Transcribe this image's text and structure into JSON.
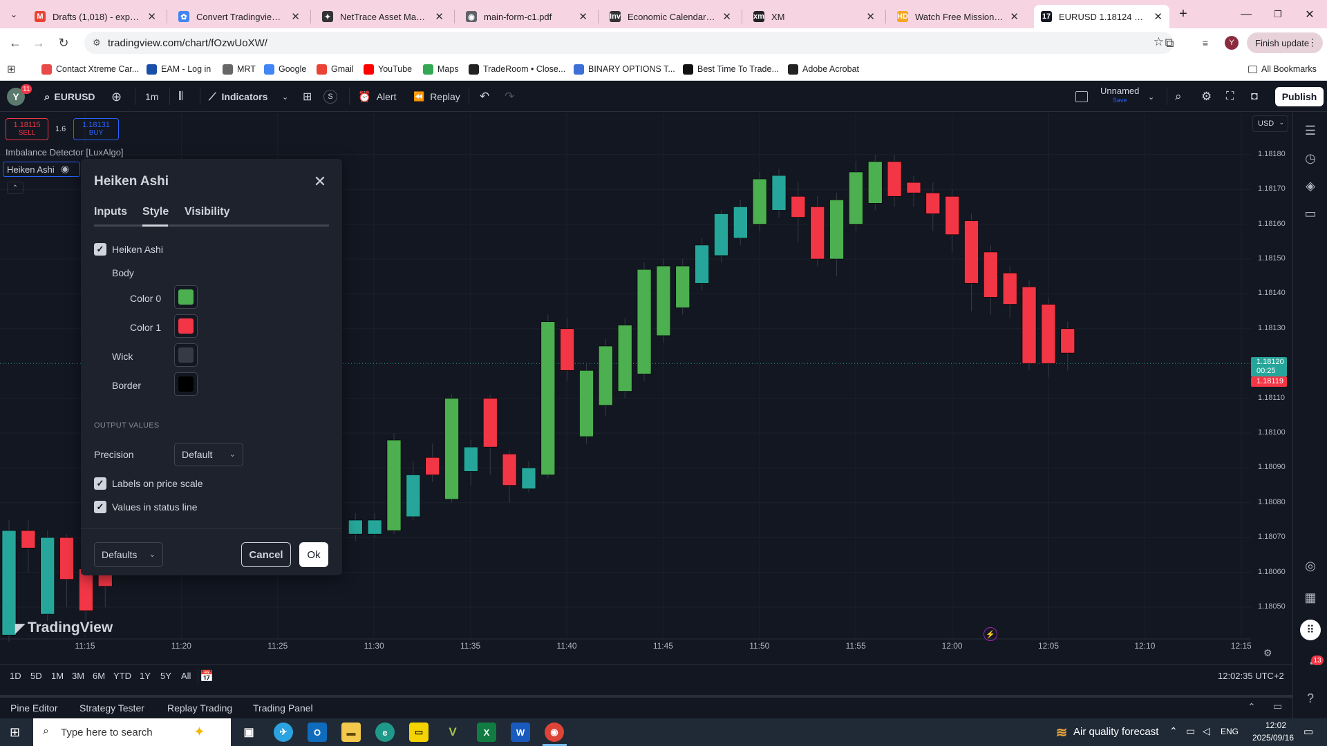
{
  "browser": {
    "tabs": [
      {
        "label": "Drafts (1,018) - experiakol",
        "fav_color": "#ea4335",
        "fav_glyph": "M"
      },
      {
        "label": "Convert Tradingview script",
        "fav_color": "#4285f4",
        "fav_glyph": "✿"
      },
      {
        "label": "NetTrace Asset Management",
        "fav_color": "#333333",
        "fav_glyph": "✦"
      },
      {
        "label": "main-form-c1.pdf",
        "fav_color": "#5f6368",
        "fav_glyph": "◉"
      },
      {
        "label": "Economic Calendar - Investing",
        "fav_color": "#333333",
        "fav_glyph": "Inv"
      },
      {
        "label": "XM",
        "fav_color": "#222222",
        "fav_glyph": "xm"
      },
      {
        "label": "Watch Free Mission: Impossible",
        "fav_color": "#f5a623",
        "fav_glyph": "HD"
      },
      {
        "label": "EURUSD 1.18124 ▲ +0.44%",
        "fav_color": "#131722",
        "fav_glyph": "17"
      }
    ],
    "new_tab_glyph": "+",
    "url": "tradingview.com/chart/fOzwUoXW/",
    "finish_update": "Finish update",
    "profile_initial": "Y",
    "bookmarks": [
      {
        "label": "Contact Xtreme Car...",
        "color": "#e84a4a"
      },
      {
        "label": "EAM - Log in",
        "color": "#1a4fa8"
      },
      {
        "label": "MRT",
        "color": "#666666"
      },
      {
        "label": "Google",
        "color": "#4285f4"
      },
      {
        "label": "Gmail",
        "color": "#ea4335"
      },
      {
        "label": "YouTube",
        "color": "#ff0000"
      },
      {
        "label": "Maps",
        "color": "#34a853"
      },
      {
        "label": "TradeRoom • Close...",
        "color": "#222222"
      },
      {
        "label": "BINARY OPTIONS T...",
        "color": "#3d6fd8"
      },
      {
        "label": "Best Time To Trade...",
        "color": "#111111"
      },
      {
        "label": "Adobe Acrobat",
        "color": "#222222"
      }
    ],
    "all_bookmarks": "All Bookmarks"
  },
  "tv": {
    "avatar": "Y",
    "notif_count": "11",
    "symbol": "EURUSD",
    "interval": "1m",
    "indicators": "Indicators",
    "alert": "Alert",
    "replay": "Replay",
    "layout_name": "Unnamed",
    "layout_status": "Save",
    "publish": "Publish",
    "currency": "USD"
  },
  "quote": {
    "sell_price": "1.18115",
    "sell_label": "SELL",
    "spread": "1.6",
    "buy_price": "1.18131",
    "buy_label": "BUY"
  },
  "indicators_on_chart": {
    "first": "Imbalance Detector [LuxAlgo]",
    "second": "Heiken Ashi"
  },
  "dialog": {
    "title": "Heiken Ashi",
    "tabs": [
      "Inputs",
      "Style",
      "Visibility"
    ],
    "active_tab": "Style",
    "heiken_ashi_label": "Heiken Ashi",
    "body_label": "Body",
    "color0_label": "Color 0",
    "color1_label": "Color 1",
    "wick_label": "Wick",
    "border_label": "Border",
    "output_values": "OUTPUT VALUES",
    "precision_label": "Precision",
    "precision_value": "Default",
    "labels_on_scale": "Labels on price scale",
    "values_in_status": "Values in status line",
    "defaults": "Defaults",
    "cancel": "Cancel",
    "ok": "Ok"
  },
  "colors": {
    "up": "#26a69a",
    "down": "#f23645",
    "bull_green": "#4caf50",
    "swatch_color0": "#4caf50",
    "swatch_color1": "#f23645",
    "swatch_wick": "#363a45",
    "swatch_border": "#000000"
  },
  "price_scale": {
    "labels": [
      "1.18180",
      "1.18170",
      "1.18160",
      "1.18150",
      "1.18140",
      "1.18130",
      "1.18110",
      "1.18100",
      "1.18090",
      "1.18080",
      "1.18070",
      "1.18060",
      "1.18050"
    ],
    "current_price": "1.18120",
    "countdown": "00:25",
    "sell_tag": "1.18119"
  },
  "time_axis": {
    "labels": [
      "11:15",
      "11:20",
      "11:25",
      "11:30",
      "11:35",
      "11:40",
      "11:45",
      "11:50",
      "11:55",
      "12:00",
      "12:05",
      "12:10",
      "12:15"
    ]
  },
  "chart_data": {
    "type": "candlestick",
    "title": "EURUSD 1m Heiken Ashi",
    "y_range": [
      1.18043,
      1.18191
    ],
    "candles": [
      {
        "t": 0,
        "o": 1.18072,
        "c": 1.18042,
        "h": 1.18075,
        "l": 1.1804,
        "dir": "up"
      },
      {
        "t": 1,
        "o": 1.18067,
        "c": 1.18072,
        "h": 1.18075,
        "l": 1.1806,
        "dir": "down"
      },
      {
        "t": 2,
        "o": 1.1807,
        "c": 1.18048,
        "h": 1.18072,
        "l": 1.18046,
        "dir": "up"
      },
      {
        "t": 3,
        "o": 1.18058,
        "c": 1.1807,
        "h": 1.18071,
        "l": 1.1805,
        "dir": "down"
      },
      {
        "t": 4,
        "o": 1.18049,
        "c": 1.18061,
        "h": 1.18063,
        "l": 1.18046,
        "dir": "down"
      },
      {
        "t": 5,
        "o": 1.18056,
        "c": 1.18062,
        "h": 1.18064,
        "l": 1.1805,
        "dir": "down"
      },
      {
        "t": 6,
        "o": 1.18062,
        "c": 1.18077,
        "h": 1.18078,
        "l": 1.18061,
        "dir": "up"
      },
      {
        "t": 18,
        "o": 1.18071,
        "c": 1.18075,
        "h": 1.18077,
        "l": 1.18069,
        "dir": "up"
      },
      {
        "t": 19,
        "o": 1.18071,
        "c": 1.18075,
        "h": 1.18077,
        "l": 1.1807,
        "dir": "up"
      },
      {
        "t": 20,
        "o": 1.18072,
        "c": 1.18098,
        "h": 1.181,
        "l": 1.18071,
        "dir": "up"
      },
      {
        "t": 21,
        "o": 1.18076,
        "c": 1.18088,
        "h": 1.18092,
        "l": 1.18075,
        "dir": "up"
      },
      {
        "t": 22,
        "o": 1.18093,
        "c": 1.18088,
        "h": 1.18097,
        "l": 1.18086,
        "dir": "down"
      },
      {
        "t": 23,
        "o": 1.18081,
        "c": 1.1811,
        "h": 1.18111,
        "l": 1.1808,
        "dir": "up"
      },
      {
        "t": 24,
        "o": 1.18089,
        "c": 1.18096,
        "h": 1.18098,
        "l": 1.18085,
        "dir": "up"
      },
      {
        "t": 25,
        "o": 1.1811,
        "c": 1.18096,
        "h": 1.18111,
        "l": 1.18088,
        "dir": "down"
      },
      {
        "t": 26,
        "o": 1.18094,
        "c": 1.18085,
        "h": 1.18095,
        "l": 1.1808,
        "dir": "down"
      },
      {
        "t": 27,
        "o": 1.18084,
        "c": 1.1809,
        "h": 1.18092,
        "l": 1.18083,
        "dir": "up"
      },
      {
        "t": 28,
        "o": 1.18088,
        "c": 1.18132,
        "h": 1.18134,
        "l": 1.18087,
        "dir": "up"
      },
      {
        "t": 29,
        "o": 1.1813,
        "c": 1.18118,
        "h": 1.18133,
        "l": 1.18115,
        "dir": "down"
      },
      {
        "t": 30,
        "o": 1.18099,
        "c": 1.18118,
        "h": 1.1812,
        "l": 1.18097,
        "dir": "up"
      },
      {
        "t": 31,
        "o": 1.18108,
        "c": 1.18125,
        "h": 1.18127,
        "l": 1.18105,
        "dir": "up"
      },
      {
        "t": 32,
        "o": 1.18112,
        "c": 1.18131,
        "h": 1.18133,
        "l": 1.1811,
        "dir": "up"
      },
      {
        "t": 33,
        "o": 1.18117,
        "c": 1.18147,
        "h": 1.18149,
        "l": 1.18115,
        "dir": "up"
      },
      {
        "t": 34,
        "o": 1.18128,
        "c": 1.18148,
        "h": 1.1815,
        "l": 1.18126,
        "dir": "up"
      },
      {
        "t": 35,
        "o": 1.18136,
        "c": 1.18148,
        "h": 1.1815,
        "l": 1.18134,
        "dir": "up"
      },
      {
        "t": 36,
        "o": 1.18143,
        "c": 1.18154,
        "h": 1.18156,
        "l": 1.18141,
        "dir": "up"
      },
      {
        "t": 37,
        "o": 1.18151,
        "c": 1.18163,
        "h": 1.18164,
        "l": 1.18149,
        "dir": "up"
      },
      {
        "t": 38,
        "o": 1.18156,
        "c": 1.18165,
        "h": 1.18167,
        "l": 1.18154,
        "dir": "up"
      },
      {
        "t": 39,
        "o": 1.1816,
        "c": 1.18173,
        "h": 1.18175,
        "l": 1.18158,
        "dir": "up"
      },
      {
        "t": 40,
        "o": 1.18164,
        "c": 1.18174,
        "h": 1.18176,
        "l": 1.18162,
        "dir": "up"
      },
      {
        "t": 41,
        "o": 1.18168,
        "c": 1.18162,
        "h": 1.18172,
        "l": 1.18155,
        "dir": "down"
      },
      {
        "t": 42,
        "o": 1.18165,
        "c": 1.1815,
        "h": 1.18168,
        "l": 1.18148,
        "dir": "down"
      },
      {
        "t": 43,
        "o": 1.1815,
        "c": 1.18167,
        "h": 1.18169,
        "l": 1.18145,
        "dir": "up"
      },
      {
        "t": 44,
        "o": 1.1816,
        "c": 1.18175,
        "h": 1.18178,
        "l": 1.18158,
        "dir": "up"
      },
      {
        "t": 45,
        "o": 1.18166,
        "c": 1.18178,
        "h": 1.1818,
        "l": 1.18164,
        "dir": "up"
      },
      {
        "t": 46,
        "o": 1.18178,
        "c": 1.18168,
        "h": 1.1818,
        "l": 1.18165,
        "dir": "down"
      },
      {
        "t": 47,
        "o": 1.18172,
        "c": 1.18169,
        "h": 1.18174,
        "l": 1.18165,
        "dir": "down"
      },
      {
        "t": 48,
        "o": 1.18169,
        "c": 1.18163,
        "h": 1.18172,
        "l": 1.18158,
        "dir": "down"
      },
      {
        "t": 49,
        "o": 1.18168,
        "c": 1.18157,
        "h": 1.1817,
        "l": 1.18152,
        "dir": "down"
      },
      {
        "t": 50,
        "o": 1.18161,
        "c": 1.18143,
        "h": 1.18163,
        "l": 1.18135,
        "dir": "down"
      },
      {
        "t": 51,
        "o": 1.18152,
        "c": 1.18139,
        "h": 1.18154,
        "l": 1.18134,
        "dir": "down"
      },
      {
        "t": 52,
        "o": 1.18146,
        "c": 1.18137,
        "h": 1.18148,
        "l": 1.18133,
        "dir": "down"
      },
      {
        "t": 53,
        "o": 1.18142,
        "c": 1.1812,
        "h": 1.18144,
        "l": 1.18118,
        "dir": "down"
      },
      {
        "t": 54,
        "o": 1.18137,
        "c": 1.1812,
        "h": 1.18139,
        "l": 1.18116,
        "dir": "down"
      },
      {
        "t": 55,
        "o": 1.1813,
        "c": 1.18123,
        "h": 1.18132,
        "l": 1.18118,
        "dir": "down"
      }
    ]
  },
  "range_bar": {
    "buttons": [
      "1D",
      "5D",
      "1M",
      "3M",
      "6M",
      "YTD",
      "1Y",
      "5Y",
      "All"
    ],
    "clock": "12:02:35 UTC+2"
  },
  "bottom_panel": {
    "tabs": [
      "Pine Editor",
      "Strategy Tester",
      "Replay Trading",
      "Trading Panel"
    ]
  },
  "right_sidebar": {
    "badge": "13"
  },
  "watermark": "TradingView",
  "taskbar": {
    "search_placeholder": "Type here to search",
    "weather": "Air quality forecast",
    "lang": "ENG",
    "time": "12:02",
    "date": "2025/09/16"
  }
}
